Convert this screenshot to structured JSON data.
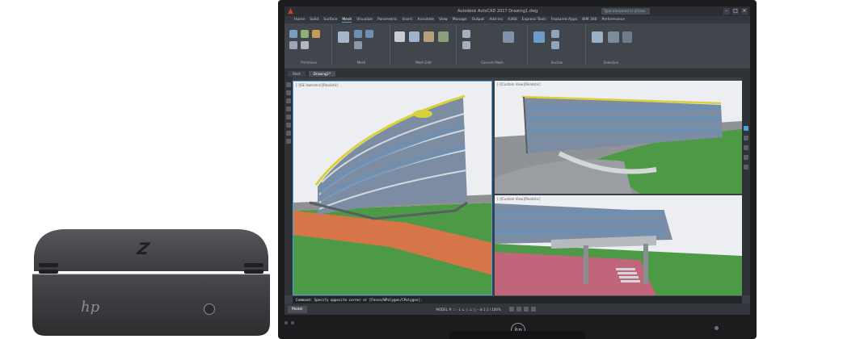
{
  "app": {
    "title_text": "Autodesk AutoCAD 2017   Drawing1.dwg",
    "search_placeholder": "Type a keyword or phrase",
    "window_buttons": [
      "–",
      "□",
      "✕"
    ],
    "logo_icon": "autocad-a-icon"
  },
  "ribbon": {
    "tabs": [
      "Home",
      "Solid",
      "Surface",
      "Mesh",
      "Visualize",
      "Parametric",
      "Insert",
      "Annotate",
      "View",
      "Manage",
      "Output",
      "Add-ins",
      "A360",
      "Express Tools",
      "Featured Apps",
      "BIM 360",
      "Performance"
    ],
    "groups": [
      {
        "label": "Primitives"
      },
      {
        "label": "Mesh"
      },
      {
        "label": "Mesh Edit"
      },
      {
        "label": "Convert Mesh"
      },
      {
        "label": "Section"
      },
      {
        "label": "Selection"
      }
    ]
  },
  "doc_tabs": [
    "Start",
    "Drawing1*"
  ],
  "viewports": {
    "left_label": "[-][SE Isometric][Realistic]",
    "top_right_label": "[-][Custom View][Realistic]",
    "bottom_right_label": "[-][Custom View][Realistic]"
  },
  "command_line": "Command: Specify opposite corner or [Fence/WPolygon/CPolygon]:",
  "status": {
    "model_tab": "Model",
    "coords": "MODEL  # ::: - L ⊾ ○ ∠ □ - ⊞  1:1 / 100%"
  },
  "hardware": {
    "brand_logo_text": "hp",
    "pc_logo_text": "Z"
  },
  "colors": {
    "autocad_red": "#d83a2a",
    "accent_blue": "#4aa3df",
    "grass_green": "#4c9a46",
    "terrain_orange": "#d67548",
    "glass_blue": "#6f8fb0",
    "roof_yellow": "#d9d03a",
    "pc_body": "#3a3b3d"
  }
}
